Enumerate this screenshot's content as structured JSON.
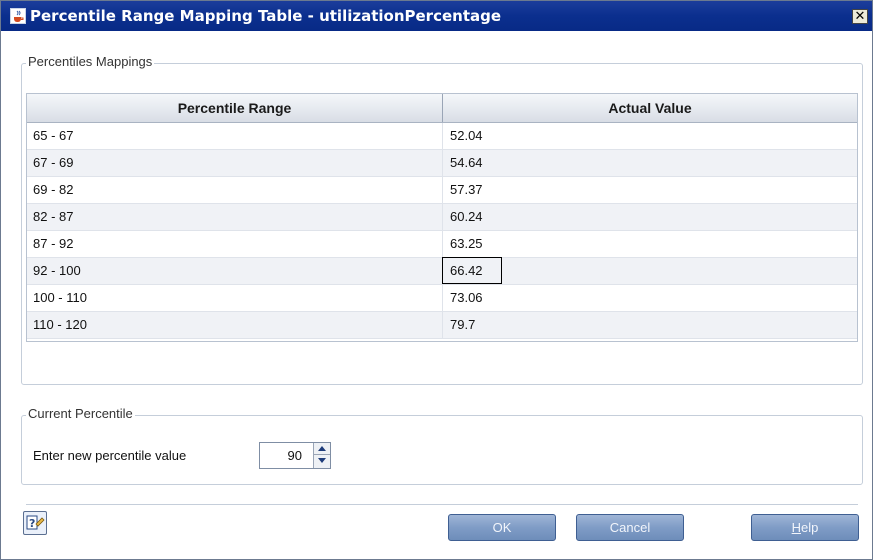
{
  "window": {
    "title": "Percentile Range Mapping Table - utilizationPercentage",
    "close_glyph": "✕"
  },
  "mappings": {
    "legend": "Percentiles Mappings",
    "columns": [
      "Percentile Range",
      "Actual Value"
    ],
    "rows": [
      {
        "range": "65 - 67",
        "value": "52.04"
      },
      {
        "range": "67 - 69",
        "value": "54.64"
      },
      {
        "range": "69 - 82",
        "value": "57.37"
      },
      {
        "range": "82 - 87",
        "value": "60.24"
      },
      {
        "range": "87 - 92",
        "value": "63.25"
      },
      {
        "range": "92 - 100",
        "value": "66.42"
      },
      {
        "range": "100 - 110",
        "value": "73.06"
      },
      {
        "range": "110 - 120",
        "value": "79.7"
      }
    ],
    "selected_row": 5
  },
  "current": {
    "legend": "Current Percentile",
    "label": "Enter new percentile value",
    "value": "90"
  },
  "footer": {
    "ok_label": "OK",
    "cancel_label": "Cancel",
    "help_mnemonic": "H",
    "help_rest": "elp",
    "help_icon": "help-icon"
  },
  "colors": {
    "title_bar": "#0b2f8e",
    "button": "#7f9cc6"
  }
}
